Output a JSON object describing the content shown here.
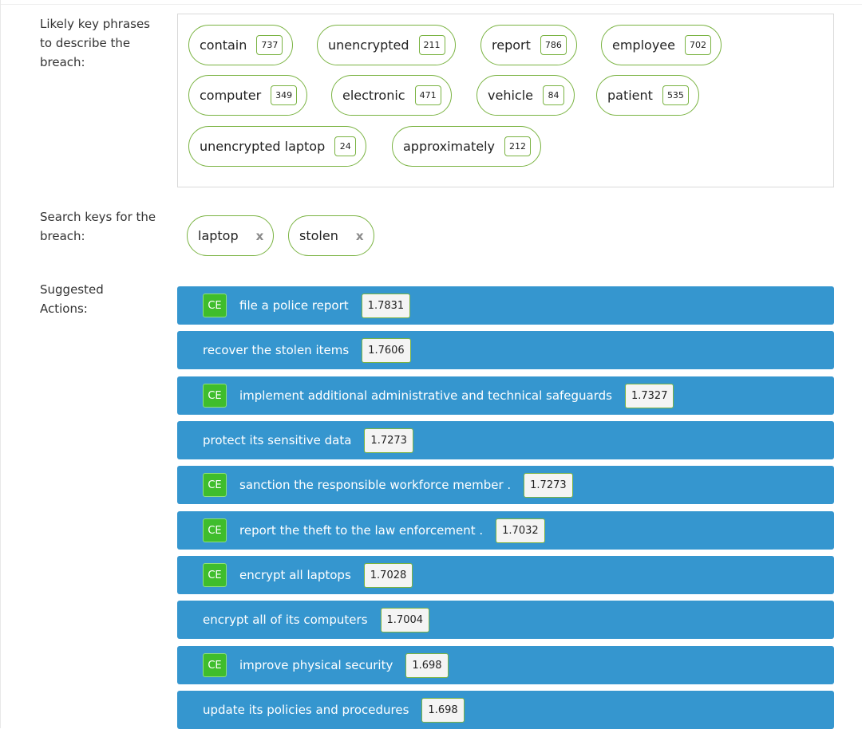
{
  "labels": {
    "phrases": "Likely key phrases to describe the breach:",
    "search": "Search keys for the breach:",
    "actions": "Suggested Actions:"
  },
  "key_phrases": [
    {
      "text": "contain",
      "count": "737"
    },
    {
      "text": "unencrypted",
      "count": "211"
    },
    {
      "text": "report",
      "count": "786"
    },
    {
      "text": "employee",
      "count": "702"
    },
    {
      "text": "computer",
      "count": "349"
    },
    {
      "text": "electronic",
      "count": "471"
    },
    {
      "text": "vehicle",
      "count": "84"
    },
    {
      "text": "patient",
      "count": "535"
    },
    {
      "text": "unencrypted laptop",
      "count": "24"
    },
    {
      "text": "approximately",
      "count": "212"
    }
  ],
  "search_keys": [
    {
      "text": "laptop",
      "remove": "x"
    },
    {
      "text": "stolen",
      "remove": "x"
    }
  ],
  "ce_badge": "CE",
  "actions": [
    {
      "text": "file a police report",
      "score": "1.7831",
      "ce": true
    },
    {
      "text": "recover the stolen items",
      "score": "1.7606",
      "ce": false
    },
    {
      "text": "implement additional administrative and technical safeguards",
      "score": "1.7327",
      "ce": true
    },
    {
      "text": "protect its sensitive data",
      "score": "1.7273",
      "ce": false
    },
    {
      "text": "sanction the responsible workforce member .",
      "score": "1.7273",
      "ce": true
    },
    {
      "text": "report the theft to the law enforcement .",
      "score": "1.7032",
      "ce": true
    },
    {
      "text": "encrypt all laptops",
      "score": "1.7028",
      "ce": true
    },
    {
      "text": "encrypt all of its computers",
      "score": "1.7004",
      "ce": false
    },
    {
      "text": "improve physical security",
      "score": "1.698",
      "ce": true
    },
    {
      "text": "update its policies and procedures",
      "score": "1.698",
      "ce": false
    }
  ],
  "colors": {
    "action_bg": "#3596cf",
    "ce_bg": "#3fbd2c",
    "chip_border": "#7ab342"
  }
}
